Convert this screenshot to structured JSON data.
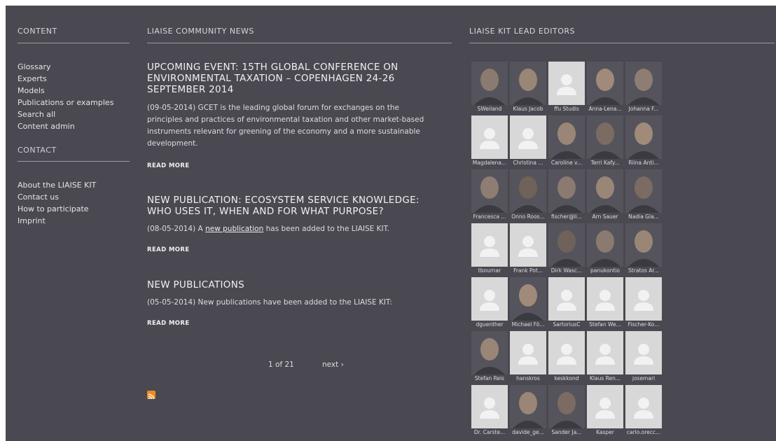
{
  "headers": {
    "content": "CONTENT",
    "news": "LIAISE COMMUNITY NEWS",
    "editors": "LIAISE KIT LEAD EDITORS",
    "contact": "CONTACT"
  },
  "content_menu": [
    "Glossary",
    "Experts",
    "Models",
    "Publications or examples",
    "Search all",
    "Content admin"
  ],
  "contact_menu": [
    "About the LIAISE KIT",
    "Contact us",
    "How to participate",
    "Imprint"
  ],
  "news": [
    {
      "title": "UPCOMING EVENT: 15TH GLOBAL CONFERENCE ON ENVIRONMENTAL TAXATION – COPENHAGEN 24-26 SEPTEMBER 2014",
      "body": "(09-05-2014) GCET is the leading global forum for exchanges on the principles and practices of environmental taxation and other market-based instruments relevant for greening of the economy and a more sustainable development.",
      "read_more": "READ MORE"
    },
    {
      "title": "NEW PUBLICATION: ECOSYSTEM SERVICE KNOWLEDGE: WHO USES IT, WHEN AND FOR WHAT PURPOSE?",
      "body_prefix": "(08-05-2014) A ",
      "body_link": "new publication",
      "body_suffix": " has been added to the LIAISE KIT.",
      "read_more": "READ MORE"
    },
    {
      "title": "NEW PUBLICATIONS",
      "body": "(05-05-2014) New publications have been added to the LIAISE KIT:",
      "read_more": "READ MORE"
    }
  ],
  "pager": {
    "status": "1 of 21",
    "next": "next ›"
  },
  "editors": [
    {
      "name": "SWeiland",
      "photo": true
    },
    {
      "name": "Klaus Jacob",
      "photo": true
    },
    {
      "name": "ffu Studis",
      "photo": false
    },
    {
      "name": "Anna-Lena...",
      "photo": true
    },
    {
      "name": "Johanna F...",
      "photo": true
    },
    {
      "name": "Magdalena...",
      "photo": false
    },
    {
      "name": "Christina ...",
      "photo": false
    },
    {
      "name": "Caroline v...",
      "photo": true
    },
    {
      "name": "Terri Kafy...",
      "photo": true
    },
    {
      "name": "Riina Anti...",
      "photo": true
    },
    {
      "name": "Francesca ...",
      "photo": true
    },
    {
      "name": "Onno Roos...",
      "photo": true
    },
    {
      "name": "fischer@li...",
      "photo": true
    },
    {
      "name": "Arn Sauer",
      "photo": true
    },
    {
      "name": "Nadia Gla...",
      "photo": true
    },
    {
      "name": "tbournar",
      "photo": false
    },
    {
      "name": "Frank Pot...",
      "photo": false
    },
    {
      "name": "Dirk Wasc...",
      "photo": true
    },
    {
      "name": "panukontio",
      "photo": true
    },
    {
      "name": "Stratos Ar...",
      "photo": true
    },
    {
      "name": "dguenther",
      "photo": false
    },
    {
      "name": "Michael Fö...",
      "photo": true
    },
    {
      "name": "SartoriusC",
      "photo": false
    },
    {
      "name": "Stefan We...",
      "photo": false
    },
    {
      "name": "Fischer-Ko...",
      "photo": false
    },
    {
      "name": "Stefan Reis",
      "photo": true
    },
    {
      "name": "hanskros",
      "photo": false
    },
    {
      "name": "keskkond",
      "photo": false
    },
    {
      "name": "Klaus Ren...",
      "photo": false
    },
    {
      "name": "josemari",
      "photo": false
    },
    {
      "name": "Dr. Carste...",
      "photo": false
    },
    {
      "name": "davide_ge...",
      "photo": true
    },
    {
      "name": "Sander Ja...",
      "photo": true
    },
    {
      "name": "Kasper",
      "photo": false
    },
    {
      "name": "carlo.orecc...",
      "photo": false
    }
  ],
  "colors": {
    "panel": "#4a4951",
    "rss": "#f08a24",
    "placeholder": "#d8d8d8"
  },
  "icons": {
    "rss": "rss-feed-icon",
    "avatar": "default-user-icon"
  }
}
